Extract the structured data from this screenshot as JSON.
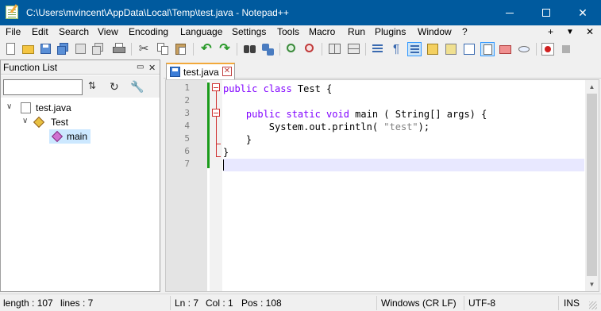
{
  "window": {
    "title": "C:\\Users\\mvincent\\AppData\\Local\\Temp\\test.java - Notepad++"
  },
  "menu": {
    "items": [
      "File",
      "Edit",
      "Search",
      "View",
      "Encoding",
      "Language",
      "Settings",
      "Tools",
      "Macro",
      "Run",
      "Plugins",
      "Window",
      "?"
    ],
    "right": [
      "+",
      "▼",
      "✕"
    ]
  },
  "function_list": {
    "title": "Function List",
    "search_value": "",
    "tree": {
      "file": "test.java",
      "class": "Test",
      "method": "main"
    }
  },
  "tab": {
    "label": "test.java"
  },
  "editor": {
    "line_numbers": [
      "1",
      "2",
      "3",
      "4",
      "5",
      "6",
      "7"
    ],
    "lines": [
      [
        {
          "t": "public class",
          "c": "kw"
        },
        {
          "t": " Test {",
          "c": "txt"
        }
      ],
      [],
      [
        {
          "t": "    ",
          "c": "txt"
        },
        {
          "t": "public static void",
          "c": "kw"
        },
        {
          "t": " main ( String[] args) {",
          "c": "txt"
        }
      ],
      [
        {
          "t": "        System.out.println( ",
          "c": "txt"
        },
        {
          "t": "\"test\"",
          "c": "str"
        },
        {
          "t": ");",
          "c": "txt"
        }
      ],
      [
        {
          "t": "    }",
          "c": "txt"
        }
      ],
      [
        {
          "t": "}",
          "c": "txt"
        }
      ],
      []
    ]
  },
  "status": {
    "length": "length : 107",
    "lines": "lines : 7",
    "ln": "Ln : 7",
    "col": "Col : 1",
    "pos": "Pos : 108",
    "eol": "Windows (CR LF)",
    "encoding": "UTF-8",
    "mode": "INS"
  },
  "icons": {
    "toolbar": [
      "new-file-icon",
      "open-file-icon",
      "save-icon",
      "save-all-icon",
      "close-icon",
      "close-all-icon",
      "print-icon",
      "cut-icon",
      "copy-icon",
      "paste-icon",
      "undo-icon",
      "redo-icon",
      "find-icon",
      "replace-icon",
      "zoom-in-icon",
      "zoom-out-icon",
      "sync-vertical-icon",
      "sync-horizontal-icon",
      "word-wrap-icon",
      "show-all-chars-icon",
      "indent-guide-icon",
      "user-language-icon",
      "document-map-icon",
      "function-list-icon",
      "folder-workspace-icon",
      "monitoring-icon",
      "record-macro-icon",
      "stop-record-icon"
    ]
  }
}
